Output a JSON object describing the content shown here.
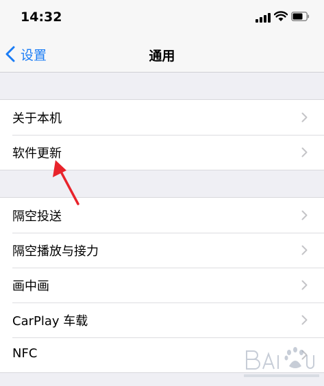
{
  "status_bar": {
    "time": "14:32"
  },
  "nav": {
    "back_label": "设置",
    "title": "通用"
  },
  "group1": [
    {
      "label": "关于本机"
    },
    {
      "label": "软件更新"
    }
  ],
  "group2": [
    {
      "label": "隔空投送"
    },
    {
      "label": "隔空播放与接力"
    },
    {
      "label": "画中画"
    },
    {
      "label": "CarPlay 车载"
    },
    {
      "label": "NFC"
    }
  ],
  "colors": {
    "accent": "#1a7cf5",
    "annotation": "#e8232b",
    "background": "#efeff4"
  },
  "icons": [
    "signal-icon",
    "wifi-icon",
    "battery-icon",
    "back-chevron-icon",
    "chevron-right-icon",
    "annotation-arrow",
    "watermark-logo"
  ]
}
